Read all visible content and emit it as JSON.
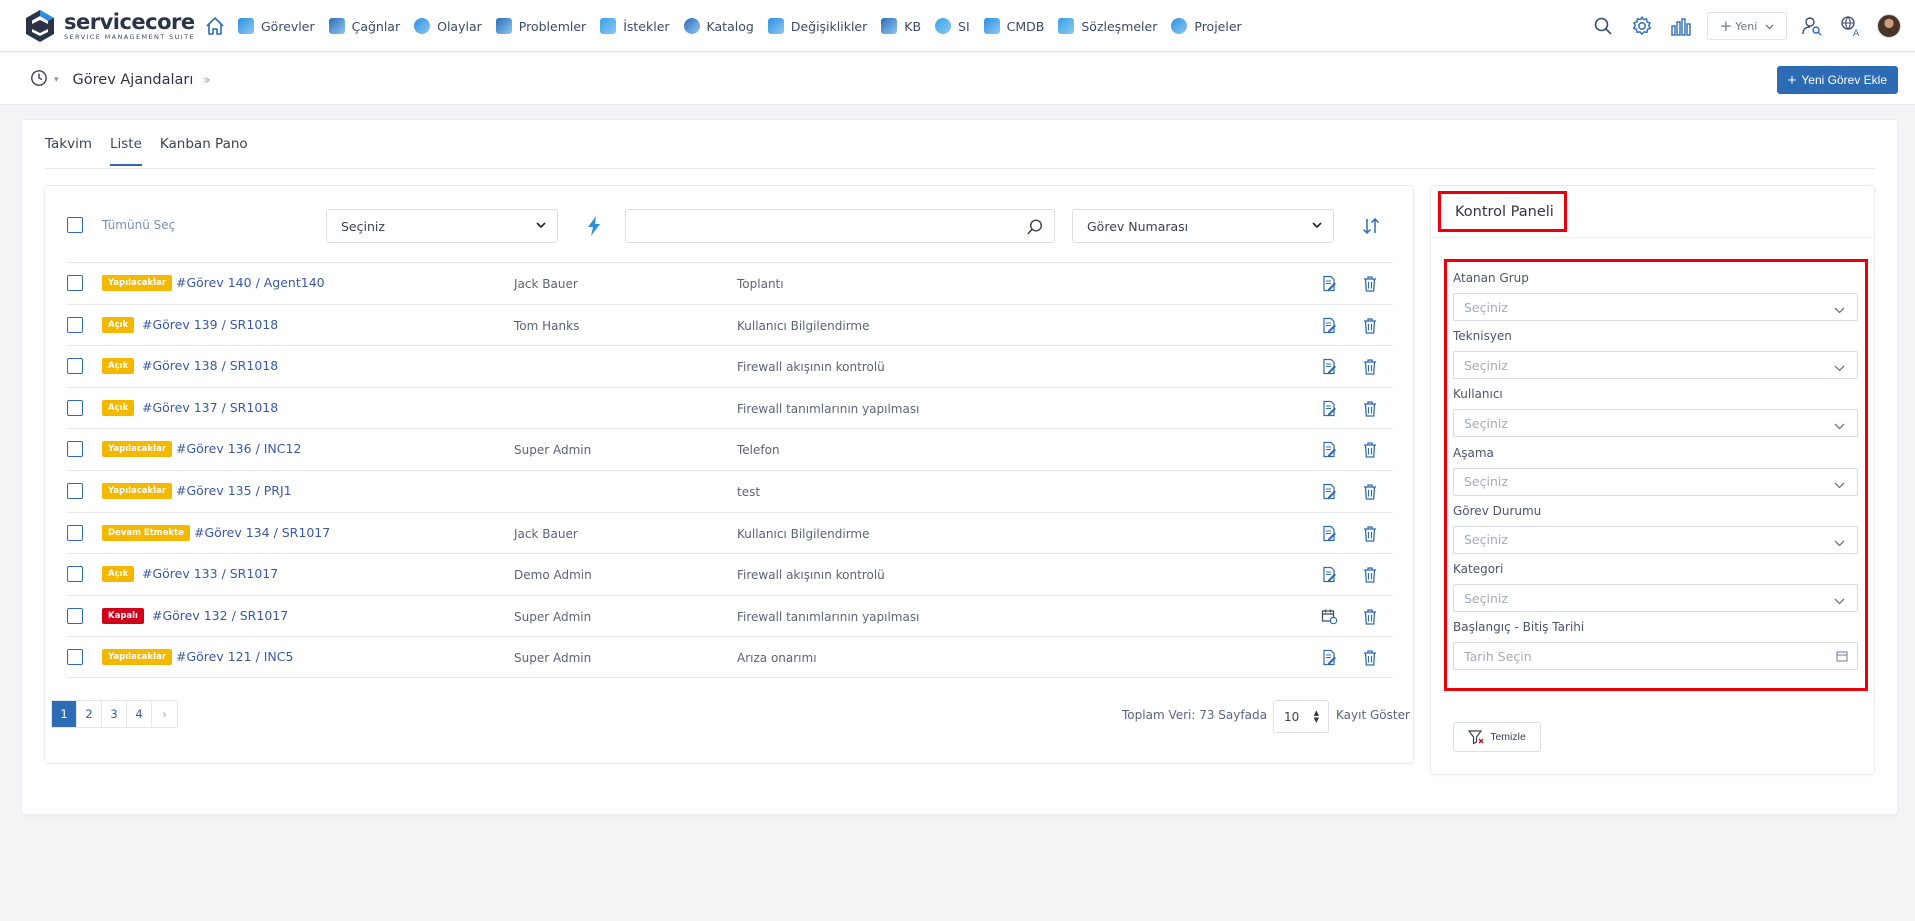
{
  "brand": {
    "name": "servicecore",
    "tagline": "SERVICE MANAGEMENT SUITE"
  },
  "nav": {
    "items": [
      {
        "label": "Görevler",
        "icon": "tasks-icon",
        "color": "#2d8fe0"
      },
      {
        "label": "Çağnlar",
        "icon": "calls-icon",
        "color": "#2d6cb5"
      },
      {
        "label": "Olaylar",
        "icon": "incidents-icon",
        "color": "#2d8fe0"
      },
      {
        "label": "Problemler",
        "icon": "problems-icon",
        "color": "#2d6cb5"
      },
      {
        "label": "İstekler",
        "icon": "requests-icon",
        "color": "#35a3e8"
      },
      {
        "label": "Katalog",
        "icon": "catalog-icon",
        "color": "#2d6cb5"
      },
      {
        "label": "Değişiklikler",
        "icon": "changes-icon",
        "color": "#2d8fe0"
      },
      {
        "label": "KB",
        "icon": "kb-icon",
        "color": "#2d6cb5"
      },
      {
        "label": "SI",
        "icon": "si-icon",
        "color": "#35a3e8"
      },
      {
        "label": "CMDB",
        "icon": "cmdb-icon",
        "color": "#2d8fe0"
      },
      {
        "label": "Sözleşmeler",
        "icon": "contracts-icon",
        "color": "#35a3e8"
      },
      {
        "label": "Projeler",
        "icon": "projects-icon",
        "color": "#2d8fe0"
      }
    ],
    "new_label": "Yeni"
  },
  "subheader": {
    "title": "Görev Ajandaları",
    "add_button": "Yeni Görev Ekle"
  },
  "tabs": [
    {
      "label": "Takvim",
      "active": false
    },
    {
      "label": "Liste",
      "active": true
    },
    {
      "label": "Kanban Pano",
      "active": false
    }
  ],
  "filters": {
    "select_all": "Tümünü Seç",
    "group_select": "Seçiniz",
    "search_value": "",
    "sort_field": "Görev Numarası"
  },
  "tasks": [
    {
      "status": "Yapılacaklar",
      "status_color": "yellow",
      "title": "#Görev 140 / Agent140",
      "technician": "Jack Bauer",
      "description": "Toplantı",
      "edit_icon": "edit-doc-icon"
    },
    {
      "status": "Açık",
      "status_color": "yellow",
      "title": "#Görev 139 / SR1018",
      "technician": "Tom Hanks",
      "description": "Kullanıcı Bilgilendirme",
      "edit_icon": "edit-doc-icon"
    },
    {
      "status": "Açık",
      "status_color": "yellow",
      "title": "#Görev 138 / SR1018",
      "technician": "",
      "description": "Firewall akışının kontrolü",
      "edit_icon": "edit-doc-icon"
    },
    {
      "status": "Açık",
      "status_color": "yellow",
      "title": "#Görev 137 / SR1018",
      "technician": "",
      "description": "Firewall tanımlarının yapılması",
      "edit_icon": "edit-doc-icon"
    },
    {
      "status": "Yapılacaklar",
      "status_color": "yellow",
      "title": "#Görev 136 / INC12",
      "technician": "Super Admin",
      "description": "Telefon",
      "edit_icon": "edit-doc-icon"
    },
    {
      "status": "Yapılacaklar",
      "status_color": "yellow",
      "title": "#Görev 135 / PRJ1",
      "technician": "",
      "description": "test",
      "edit_icon": "edit-doc-icon"
    },
    {
      "status": "Devam Etmekte",
      "status_color": "yellow",
      "title": "#Görev 134 / SR1017",
      "technician": "Jack Bauer",
      "description": "Kullanıcı Bilgilendirme",
      "edit_icon": "edit-doc-icon"
    },
    {
      "status": "Açık",
      "status_color": "yellow",
      "title": "#Görev 133 / SR1017",
      "technician": "Demo Admin",
      "description": "Firewall akışının kontrolü",
      "edit_icon": "edit-doc-icon"
    },
    {
      "status": "Kapalı",
      "status_color": "red",
      "title": "#Görev 132 / SR1017",
      "technician": "Super Admin",
      "description": "Firewall tanımlarının yapılması",
      "edit_icon": "calendar-refresh-icon"
    },
    {
      "status": "Yapılacaklar",
      "status_color": "yellow",
      "title": "#Görev 121 / INC5",
      "technician": "Super Admin",
      "description": "Arıza onarımı",
      "edit_icon": "edit-doc-icon"
    }
  ],
  "pagination": {
    "pages": [
      "1",
      "2",
      "3",
      "4"
    ],
    "current": "1",
    "next": "›",
    "total_text": "Toplam Veri: 73 Sayfada",
    "page_size": "10",
    "show_label": "Kayıt Göster"
  },
  "control_panel": {
    "title": "Kontrol Paneli",
    "fields": [
      {
        "label": "Atanan Grup",
        "placeholder": "Seçiniz",
        "type": "select"
      },
      {
        "label": "Teknisyen",
        "placeholder": "Seçiniz",
        "type": "select"
      },
      {
        "label": "Kullanıcı",
        "placeholder": "Seçiniz",
        "type": "select"
      },
      {
        "label": "Aşama",
        "placeholder": "Seçiniz",
        "type": "select"
      },
      {
        "label": "Görev Durumu",
        "placeholder": "Seçiniz",
        "type": "select"
      },
      {
        "label": "Kategori",
        "placeholder": "Seçiniz",
        "type": "select"
      },
      {
        "label": "Başlangıç - Bitiş Tarihi",
        "placeholder": "Tarih Seçin",
        "type": "date"
      }
    ],
    "clear_button": "Temizle"
  },
  "colors": {
    "accent": "#2d6cb5",
    "highlight_border": "#e8000b",
    "badge_yellow": "#f5b800",
    "badge_red": "#d0021b"
  }
}
